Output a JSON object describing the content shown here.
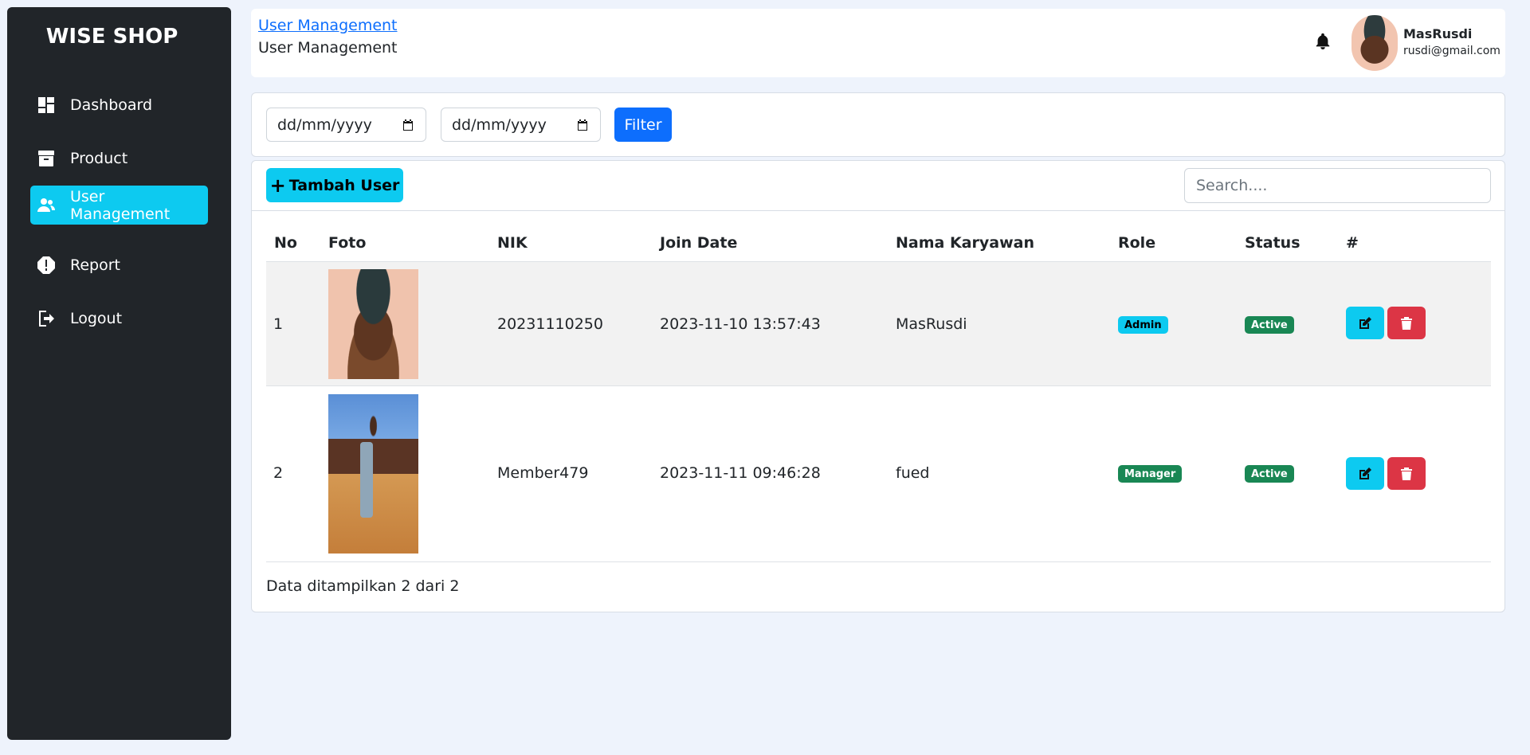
{
  "sidebar": {
    "brand": "WISE SHOP",
    "items": [
      {
        "label": "Dashboard",
        "icon": "dashboard-icon",
        "active": false
      },
      {
        "label": "Product",
        "icon": "archive-icon",
        "active": false
      },
      {
        "label": "User Management",
        "icon": "users-icon",
        "active": true
      },
      {
        "label": "Report",
        "icon": "alert-icon",
        "active": false
      },
      {
        "label": "Logout",
        "icon": "logout-icon",
        "active": false
      }
    ]
  },
  "header": {
    "breadcrumb_link": "User Management",
    "page_title": "User Management",
    "user_name": "MasRusdi",
    "user_email": "rusdi@gmail.com"
  },
  "filter": {
    "date_from_placeholder": "dd/mm/yyyy",
    "date_to_placeholder": "dd/mm/yyyy",
    "button_label": "Filter"
  },
  "table_card": {
    "add_button_label": "Tambah User",
    "search_placeholder": "Search....",
    "columns": [
      "No",
      "Foto",
      "NIK",
      "Join Date",
      "Nama Karyawan",
      "Role",
      "Status",
      "#"
    ],
    "rows": [
      {
        "no": "1",
        "nik": "20231110250",
        "join_date": "2023-11-10 13:57:43",
        "name": "MasRusdi",
        "role": "Admin",
        "status": "Active"
      },
      {
        "no": "2",
        "nik": "Member479",
        "join_date": "2023-11-11 09:46:28",
        "name": "fued",
        "role": "Manager",
        "status": "Active"
      }
    ],
    "footer": "Data ditampilkan 2 dari 2"
  },
  "colors": {
    "sidebar_bg": "#212529",
    "accent_info": "#0dcaf0",
    "primary": "#0d6efd",
    "success": "#198754",
    "danger": "#dc3545",
    "page_bg": "#eef3fc"
  }
}
